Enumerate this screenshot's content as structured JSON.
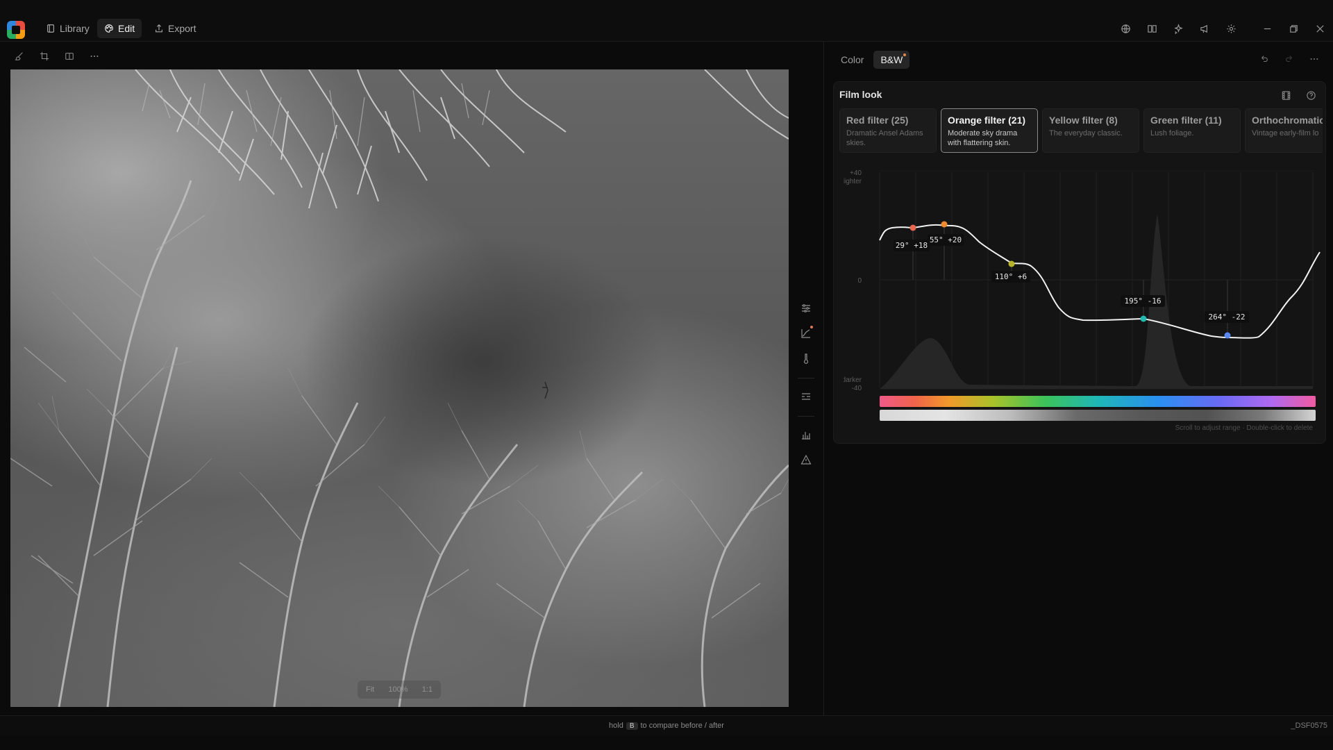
{
  "nav": {
    "tabs": [
      {
        "label": "Library",
        "icon": "library-icon"
      },
      {
        "label": "Edit",
        "icon": "palette-icon"
      },
      {
        "label": "Export",
        "icon": "export-icon"
      }
    ]
  },
  "toolbar": {
    "icons": [
      "brush-icon",
      "crop-icon",
      "compare-split-icon",
      "more-icon"
    ]
  },
  "window_controls": [
    "globe-icon",
    "book-icon",
    "sparkles-icon",
    "megaphone-icon",
    "gear-icon",
    "minimize-icon",
    "restore-icon",
    "close-icon"
  ],
  "canvas": {
    "zoom": {
      "left": "Fit",
      "value": "100%",
      "right": "1:1"
    }
  },
  "side_tools": [
    "sliders-icon",
    "curve-icon",
    "thermometer-icon",
    "list-icon",
    "histogram-icon",
    "warning-icon"
  ],
  "panel": {
    "mode_tabs": [
      {
        "label": "Color"
      },
      {
        "label": "B&W"
      }
    ],
    "header_icons": [
      "undo-icon",
      "redo-icon",
      "more-icon"
    ],
    "film_look": {
      "title": "Film look",
      "presets": [
        {
          "title": "Red filter (25)",
          "desc": "Dramatic Ansel Adams skies."
        },
        {
          "title": "Orange filter (21)",
          "desc": "Moderate sky drama with flattering skin."
        },
        {
          "title": "Yellow filter (8)",
          "desc": "The everyday classic."
        },
        {
          "title": "Green filter (11)",
          "desc": "Lush foliage."
        },
        {
          "title": "Orthochromatic",
          "desc": "Vintage early-film lo"
        }
      ],
      "graph": {
        "y_top": "+40",
        "y_top_label": "lighter",
        "y_mid": "0",
        "y_bottom_label": "darker",
        "y_bottom": "-40",
        "points": [
          {
            "hue": 29,
            "value": 18,
            "label": "29° +18",
            "color": "#e9664f"
          },
          {
            "hue": 55,
            "value": 20,
            "label": "55° +20",
            "color": "#f08a2f"
          },
          {
            "hue": 110,
            "value": 6,
            "label": "110° +6",
            "color": "#b5b32a"
          },
          {
            "hue": 195,
            "value": -16,
            "label": "195° -16",
            "color": "#22b9b0"
          },
          {
            "hue": 264,
            "value": -22,
            "label": "264° -22",
            "color": "#5b87f2"
          }
        ]
      },
      "hint": "Scroll to adjust range · Double-click to delete"
    }
  },
  "status": {
    "compare_prefix": "hold",
    "compare_key": "B",
    "compare_suffix": "to compare before / after",
    "filename": "_DSF0575"
  }
}
